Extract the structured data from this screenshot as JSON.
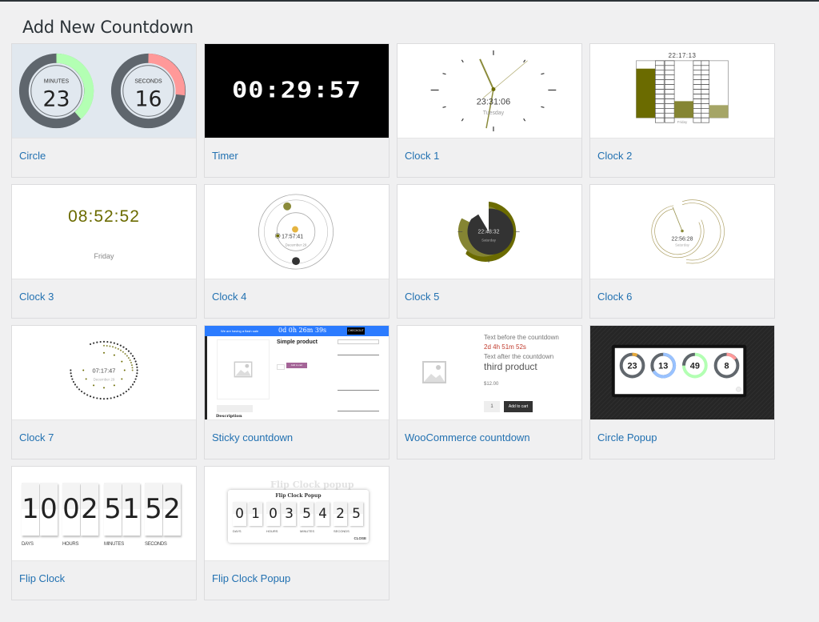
{
  "page": {
    "title": "Add New Countdown"
  },
  "colors": {
    "link": "#2271b1",
    "background": "#f0f0f1",
    "olive": "#6b6b00"
  },
  "cards": [
    {
      "label": "Circle",
      "preview": {
        "minutes_label": "MINUTES",
        "minutes": "23",
        "seconds_label": "SECONDS",
        "seconds": "16"
      }
    },
    {
      "label": "Timer",
      "preview": {
        "time": "00:29:57"
      }
    },
    {
      "label": "Clock 1",
      "preview": {
        "time": "23:31:06",
        "day": "Tuesday"
      }
    },
    {
      "label": "Clock 2",
      "preview": {
        "time": "22:17:13",
        "day": "Friday"
      }
    },
    {
      "label": "Clock 3",
      "preview": {
        "time": "08:52:52",
        "day": "Friday"
      }
    },
    {
      "label": "Clock 4",
      "preview": {
        "time": "17:57:41",
        "date": "December 29"
      }
    },
    {
      "label": "Clock 5",
      "preview": {
        "time": "22:48:32",
        "day": "Saturday"
      }
    },
    {
      "label": "Clock 6",
      "preview": {
        "time": "22:56:28",
        "day": "Saturday"
      }
    },
    {
      "label": "Clock 7",
      "preview": {
        "time": "07:17:47",
        "date": "December 29"
      }
    },
    {
      "label": "Sticky countdown",
      "preview": {
        "bar_text": "We are having a flash sale",
        "countdown": "0d 0h 26m 39s",
        "checkout": "CHECKOUT",
        "product": "Simple product",
        "cart": "Add to cart"
      }
    },
    {
      "label": "WooCommerce countdown",
      "preview": {
        "before": "Text before the countdown",
        "countdown": "2d 4h 51m 52s",
        "after": "Text after the countdown",
        "product": "third product",
        "price": "$12.00",
        "qty": "1",
        "cart": "Add to cart"
      }
    },
    {
      "label": "Circle Popup",
      "preview": {
        "days": "23",
        "hours": "13",
        "minutes": "49",
        "seconds": "8"
      }
    },
    {
      "label": "Flip Clock",
      "preview": {
        "digits": [
          "1",
          "0",
          "0",
          "2",
          "5",
          "1",
          "5",
          "2"
        ],
        "labels": [
          "DAYS",
          "HOURS",
          "MINUTES",
          "SECONDS"
        ]
      }
    },
    {
      "label": "Flip Clock Popup",
      "preview": {
        "title": "Flip Clock Popup",
        "bg_title": "Flip Clock popup",
        "digits": [
          "0",
          "1",
          "0",
          "3",
          "5",
          "4",
          "2",
          "5"
        ],
        "labels": [
          "DAYS",
          "HOURS",
          "MINUTES",
          "SECONDS"
        ],
        "close": "CLOSE"
      }
    }
  ]
}
